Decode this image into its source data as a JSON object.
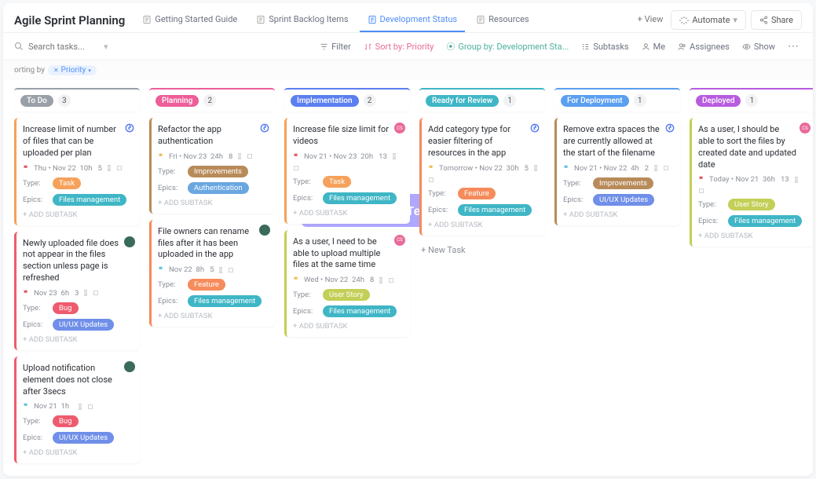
{
  "header": {
    "list_title": "Agile Sprint Planning",
    "tabs": [
      {
        "label": "Getting Started Guide"
      },
      {
        "label": "Sprint Backlog Items"
      },
      {
        "label": "Development Status",
        "active": true
      },
      {
        "label": "Resources"
      }
    ],
    "add_view": "+ View",
    "automate": "Automate",
    "share": "Share"
  },
  "toolbar": {
    "search_placeholder": "Search tasks...",
    "filter": "Filter",
    "sort": "Sort by: Priority",
    "group": "Group by: Development Sta...",
    "subtasks": "Subtasks",
    "me": "Me",
    "assignees": "Assignees",
    "show": "Show"
  },
  "sortbar": {
    "label": "orting by",
    "chip": "Priority"
  },
  "overlay_text": "This Template",
  "labels": {
    "type": "Type:",
    "epics": "Epics:",
    "add_subtask": "+ ADD SUBTASK",
    "new_task": "+ New Task"
  },
  "tag_colors": {
    "Task": "#f6a15b",
    "Bug": "#ef5b6e",
    "Feature": "#f68b5b",
    "Improvements": "#b88b5a",
    "User Story": "#c3cf56",
    "Files management": "#3fb6c6",
    "Authentication": "#6aa7e0",
    "UI/UX Updates": "#6f8fe8"
  },
  "flag_colors": {
    "urgent": "#e0525b",
    "high": "#f2b84b",
    "normal": "#5bbfd8",
    "low": "#9aa0a8"
  },
  "columns": [
    {
      "name": "To Do",
      "color": "#9aa0a8",
      "count": 3,
      "cards": [
        {
          "title": "Increase limit of number of files that can be uploaded per plan",
          "border": "#f6a15b",
          "avatar_type": "sprint",
          "flag": "urgent",
          "meta": "Thu  •  Nov 22   10h     5",
          "type": "Task",
          "epics": "Files management"
        },
        {
          "title": "Newly uploaded file does not appear in the files section unless page is refreshed",
          "border": "#ef5b6e",
          "avatar_bg": "#3a6b5a",
          "flag": "urgent",
          "meta": "Nov 23   6h     3",
          "type": "Bug",
          "epics": "UI/UX Updates"
        },
        {
          "title": "Upload notification element does not close after 3secs",
          "border": "#ef5b6e",
          "avatar_bg": "#3a6b5a",
          "flag": "normal",
          "meta": "Nov 21   1h   ",
          "type": "Bug",
          "epics": "UI/UX Updates"
        }
      ]
    },
    {
      "name": "Planning",
      "color": "#ee5e99",
      "count": 2,
      "cards": [
        {
          "title": "Refactor the app authentication",
          "border": "#b88b5a",
          "avatar_type": "sprint",
          "flag": "high",
          "meta": "Fri  •  Nov 23   24h     8",
          "type": "Improvements",
          "epics": "Authentication"
        },
        {
          "title": "File owners can rename files after it has been uploaded in the app",
          "border": "#f68b5b",
          "avatar_bg": "#3a6b5a",
          "flag": "normal",
          "meta": "Nov 22   8h     5",
          "type": "Feature",
          "epics": "Files management"
        }
      ]
    },
    {
      "name": "Implementation",
      "color": "#5b7ff0",
      "count": 2,
      "cards": [
        {
          "title": "Increase file size limit for videos",
          "border": "#f6a15b",
          "avatar_bg": "#e86a9a",
          "avatar_text": "CS",
          "flag": "urgent",
          "meta": "Nov 21  •  Nov 23   20h     13",
          "type": "Task",
          "epics": "Files management"
        },
        {
          "title": "As a user, I need to be able to upload multiple files at the same time",
          "border": "#c3cf56",
          "avatar_bg": "#e86a9a",
          "avatar_text": "CS",
          "flag": "high",
          "meta": "Wed  •  Nov 22   24h     8",
          "type": "User Story",
          "epics": "Files management"
        }
      ]
    },
    {
      "name": "Ready for Review",
      "color": "#3fb6c6",
      "count": 1,
      "cards": [
        {
          "title": "Add category type for easier filtering of resources in the app",
          "border": "#f68b5b",
          "avatar_type": "sprint",
          "flag": "high",
          "meta": "Tomorrow  •  Nov 22   30h     5",
          "type": "Feature",
          "epics": "Files management"
        }
      ],
      "show_new_task": true
    },
    {
      "name": "For Deployment",
      "color": "#5b9ff0",
      "count": 1,
      "cards": [
        {
          "title": "Remove extra spaces the are currently allowed at the start of the filename",
          "border": "#b88b5a",
          "avatar_type": "sprint",
          "flag": "normal",
          "meta": "Nov 21  •  Nov 22   4h     2",
          "type": "Improvements",
          "epics": "UI/UX Updates"
        }
      ]
    },
    {
      "name": "Deployed",
      "color": "#b85be0",
      "count": 1,
      "cards": [
        {
          "title": "As a user, I should be able to sort the files by created date and updated date",
          "border": "#c3cf56",
          "avatar_bg": "#e86a9a",
          "avatar_text": "CS",
          "flag": "urgent",
          "meta": "Today  •  Nov 21   36h     13",
          "type": "User Story",
          "epics": "Files management"
        }
      ]
    }
  ]
}
